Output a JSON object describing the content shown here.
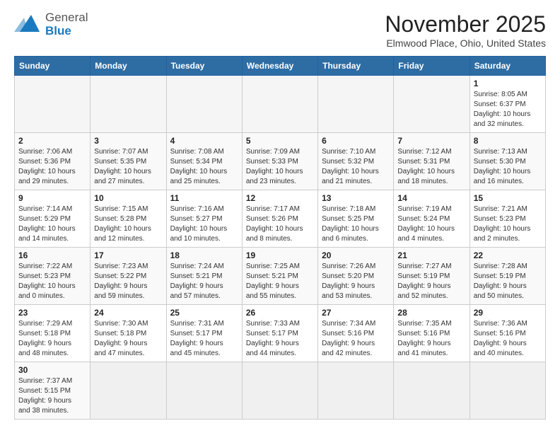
{
  "header": {
    "logo_text_normal": "General",
    "logo_text_blue": "Blue",
    "title": "November 2025",
    "subtitle": "Elmwood Place, Ohio, United States"
  },
  "days_of_week": [
    "Sunday",
    "Monday",
    "Tuesday",
    "Wednesday",
    "Thursday",
    "Friday",
    "Saturday"
  ],
  "weeks": [
    [
      {
        "day": "",
        "info": ""
      },
      {
        "day": "",
        "info": ""
      },
      {
        "day": "",
        "info": ""
      },
      {
        "day": "",
        "info": ""
      },
      {
        "day": "",
        "info": ""
      },
      {
        "day": "",
        "info": ""
      },
      {
        "day": "1",
        "info": "Sunrise: 8:05 AM\nSunset: 6:37 PM\nDaylight: 10 hours\nand 32 minutes."
      }
    ],
    [
      {
        "day": "2",
        "info": "Sunrise: 7:06 AM\nSunset: 5:36 PM\nDaylight: 10 hours\nand 29 minutes."
      },
      {
        "day": "3",
        "info": "Sunrise: 7:07 AM\nSunset: 5:35 PM\nDaylight: 10 hours\nand 27 minutes."
      },
      {
        "day": "4",
        "info": "Sunrise: 7:08 AM\nSunset: 5:34 PM\nDaylight: 10 hours\nand 25 minutes."
      },
      {
        "day": "5",
        "info": "Sunrise: 7:09 AM\nSunset: 5:33 PM\nDaylight: 10 hours\nand 23 minutes."
      },
      {
        "day": "6",
        "info": "Sunrise: 7:10 AM\nSunset: 5:32 PM\nDaylight: 10 hours\nand 21 minutes."
      },
      {
        "day": "7",
        "info": "Sunrise: 7:12 AM\nSunset: 5:31 PM\nDaylight: 10 hours\nand 18 minutes."
      },
      {
        "day": "8",
        "info": "Sunrise: 7:13 AM\nSunset: 5:30 PM\nDaylight: 10 hours\nand 16 minutes."
      }
    ],
    [
      {
        "day": "9",
        "info": "Sunrise: 7:14 AM\nSunset: 5:29 PM\nDaylight: 10 hours\nand 14 minutes."
      },
      {
        "day": "10",
        "info": "Sunrise: 7:15 AM\nSunset: 5:28 PM\nDaylight: 10 hours\nand 12 minutes."
      },
      {
        "day": "11",
        "info": "Sunrise: 7:16 AM\nSunset: 5:27 PM\nDaylight: 10 hours\nand 10 minutes."
      },
      {
        "day": "12",
        "info": "Sunrise: 7:17 AM\nSunset: 5:26 PM\nDaylight: 10 hours\nand 8 minutes."
      },
      {
        "day": "13",
        "info": "Sunrise: 7:18 AM\nSunset: 5:25 PM\nDaylight: 10 hours\nand 6 minutes."
      },
      {
        "day": "14",
        "info": "Sunrise: 7:19 AM\nSunset: 5:24 PM\nDaylight: 10 hours\nand 4 minutes."
      },
      {
        "day": "15",
        "info": "Sunrise: 7:21 AM\nSunset: 5:23 PM\nDaylight: 10 hours\nand 2 minutes."
      }
    ],
    [
      {
        "day": "16",
        "info": "Sunrise: 7:22 AM\nSunset: 5:23 PM\nDaylight: 10 hours\nand 0 minutes."
      },
      {
        "day": "17",
        "info": "Sunrise: 7:23 AM\nSunset: 5:22 PM\nDaylight: 9 hours\nand 59 minutes."
      },
      {
        "day": "18",
        "info": "Sunrise: 7:24 AM\nSunset: 5:21 PM\nDaylight: 9 hours\nand 57 minutes."
      },
      {
        "day": "19",
        "info": "Sunrise: 7:25 AM\nSunset: 5:21 PM\nDaylight: 9 hours\nand 55 minutes."
      },
      {
        "day": "20",
        "info": "Sunrise: 7:26 AM\nSunset: 5:20 PM\nDaylight: 9 hours\nand 53 minutes."
      },
      {
        "day": "21",
        "info": "Sunrise: 7:27 AM\nSunset: 5:19 PM\nDaylight: 9 hours\nand 52 minutes."
      },
      {
        "day": "22",
        "info": "Sunrise: 7:28 AM\nSunset: 5:19 PM\nDaylight: 9 hours\nand 50 minutes."
      }
    ],
    [
      {
        "day": "23",
        "info": "Sunrise: 7:29 AM\nSunset: 5:18 PM\nDaylight: 9 hours\nand 48 minutes."
      },
      {
        "day": "24",
        "info": "Sunrise: 7:30 AM\nSunset: 5:18 PM\nDaylight: 9 hours\nand 47 minutes."
      },
      {
        "day": "25",
        "info": "Sunrise: 7:31 AM\nSunset: 5:17 PM\nDaylight: 9 hours\nand 45 minutes."
      },
      {
        "day": "26",
        "info": "Sunrise: 7:33 AM\nSunset: 5:17 PM\nDaylight: 9 hours\nand 44 minutes."
      },
      {
        "day": "27",
        "info": "Sunrise: 7:34 AM\nSunset: 5:16 PM\nDaylight: 9 hours\nand 42 minutes."
      },
      {
        "day": "28",
        "info": "Sunrise: 7:35 AM\nSunset: 5:16 PM\nDaylight: 9 hours\nand 41 minutes."
      },
      {
        "day": "29",
        "info": "Sunrise: 7:36 AM\nSunset: 5:16 PM\nDaylight: 9 hours\nand 40 minutes."
      }
    ],
    [
      {
        "day": "30",
        "info": "Sunrise: 7:37 AM\nSunset: 5:15 PM\nDaylight: 9 hours\nand 38 minutes."
      },
      {
        "day": "",
        "info": ""
      },
      {
        "day": "",
        "info": ""
      },
      {
        "day": "",
        "info": ""
      },
      {
        "day": "",
        "info": ""
      },
      {
        "day": "",
        "info": ""
      },
      {
        "day": "",
        "info": ""
      }
    ]
  ]
}
